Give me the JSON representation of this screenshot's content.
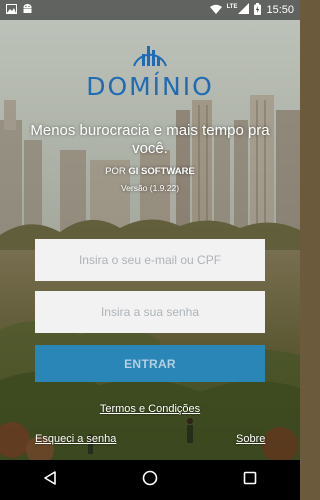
{
  "status_bar": {
    "time": "15:50",
    "network": "LTE",
    "icons": [
      "image-icon",
      "android-icon",
      "wifi-icon",
      "signal-icon",
      "battery-icon"
    ]
  },
  "logo": {
    "text": "DOMÍNIO",
    "color": "#1f6bb5"
  },
  "tagline": "Menos burocracia e mais tempo pra você.",
  "byline": {
    "prefix": "POR",
    "company": "GI SOFTWARE"
  },
  "version": "Versão (1.9.22)",
  "form": {
    "email_placeholder": "Insira o seu e-mail ou CPF",
    "password_placeholder": "Insira a sua senha",
    "submit_label": "ENTRAR",
    "submit_color": "#2a86b6"
  },
  "links": {
    "terms": "Termos e Condições",
    "forgot": "Esqueci a senha",
    "about": "Sobre"
  },
  "nav_bar": {
    "icons": [
      "back-icon",
      "home-icon",
      "recents-icon"
    ]
  }
}
